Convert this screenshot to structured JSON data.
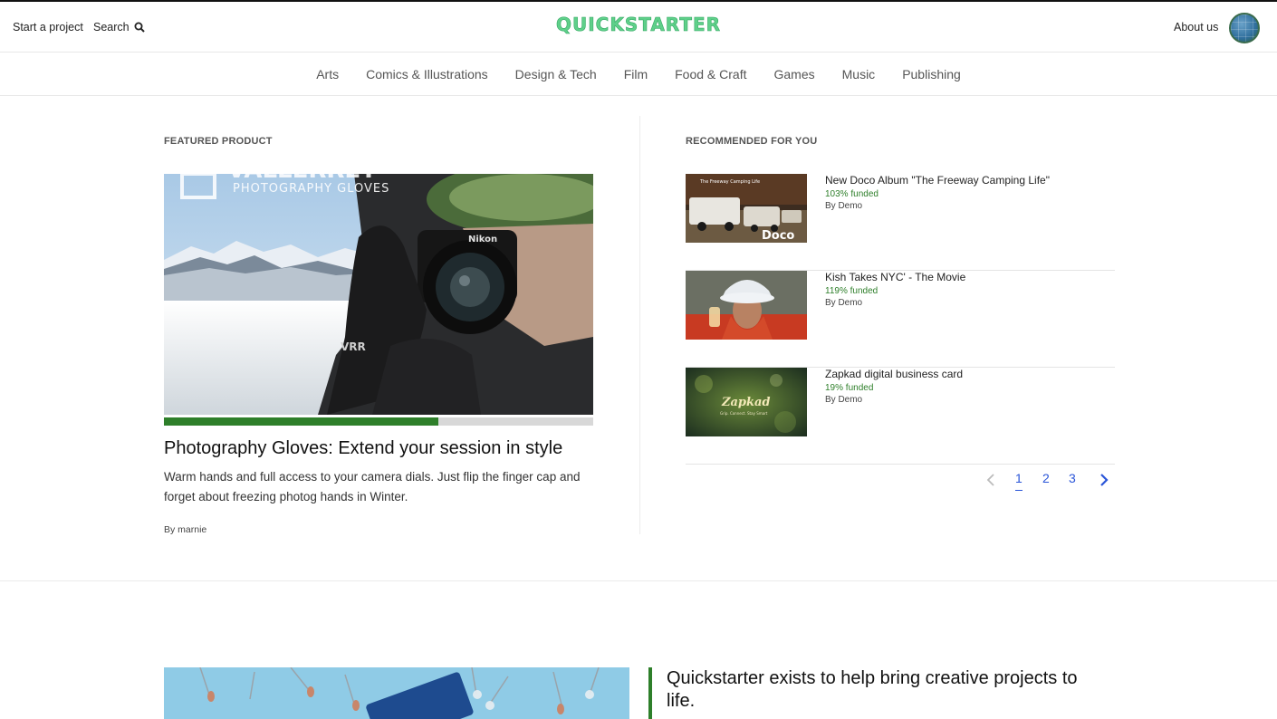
{
  "header": {
    "start_project": "Start a project",
    "search": "Search",
    "logo": "QUICKSTARTER",
    "about": "About us"
  },
  "categories": [
    "Arts",
    "Comics & Illustrations",
    "Design & Tech",
    "Film",
    "Food & Craft",
    "Games",
    "Music",
    "Publishing"
  ],
  "featured": {
    "label": "FEATURED PRODUCT",
    "image_text": "PHOTOGRAPHY GLOVES",
    "image_brand": "VALLERRET",
    "camera_brand": "Nikon",
    "funded_fraction": 0.64,
    "title": "Photography Gloves: Extend your session in style",
    "description": "Warm hands and full access to your camera dials. Just flip the finger cap and forget about freezing photog hands in Winter.",
    "by": "By marnie"
  },
  "recommended": {
    "label": "RECOMMENDED FOR YOU",
    "items": [
      {
        "title": "New Doco Album \"The Freeway Camping Life\"",
        "funded": "103% funded",
        "by": "By Demo",
        "thumb_caption": "Doco",
        "thumb_subcaption": "The Freeway Camping Life"
      },
      {
        "title": "Kish Takes NYC' - The Movie",
        "funded": "119% funded",
        "by": "By Demo"
      },
      {
        "title": "Zapkad digital business card",
        "funded": "19% funded",
        "by": "By Demo",
        "thumb_caption": "Zapkad",
        "thumb_subcaption": "Grip. Connect. Stay Smart"
      }
    ]
  },
  "pagination": {
    "prev": "‹",
    "pages": [
      "1",
      "2",
      "3"
    ],
    "active": "1",
    "next": "›"
  },
  "about_section": {
    "headline": "Quickstarter exists to help bring creative projects to life."
  },
  "colors": {
    "brand_green": "#5fd08a",
    "funded_green": "#2e7f2a",
    "link_blue": "#2a55d8"
  }
}
